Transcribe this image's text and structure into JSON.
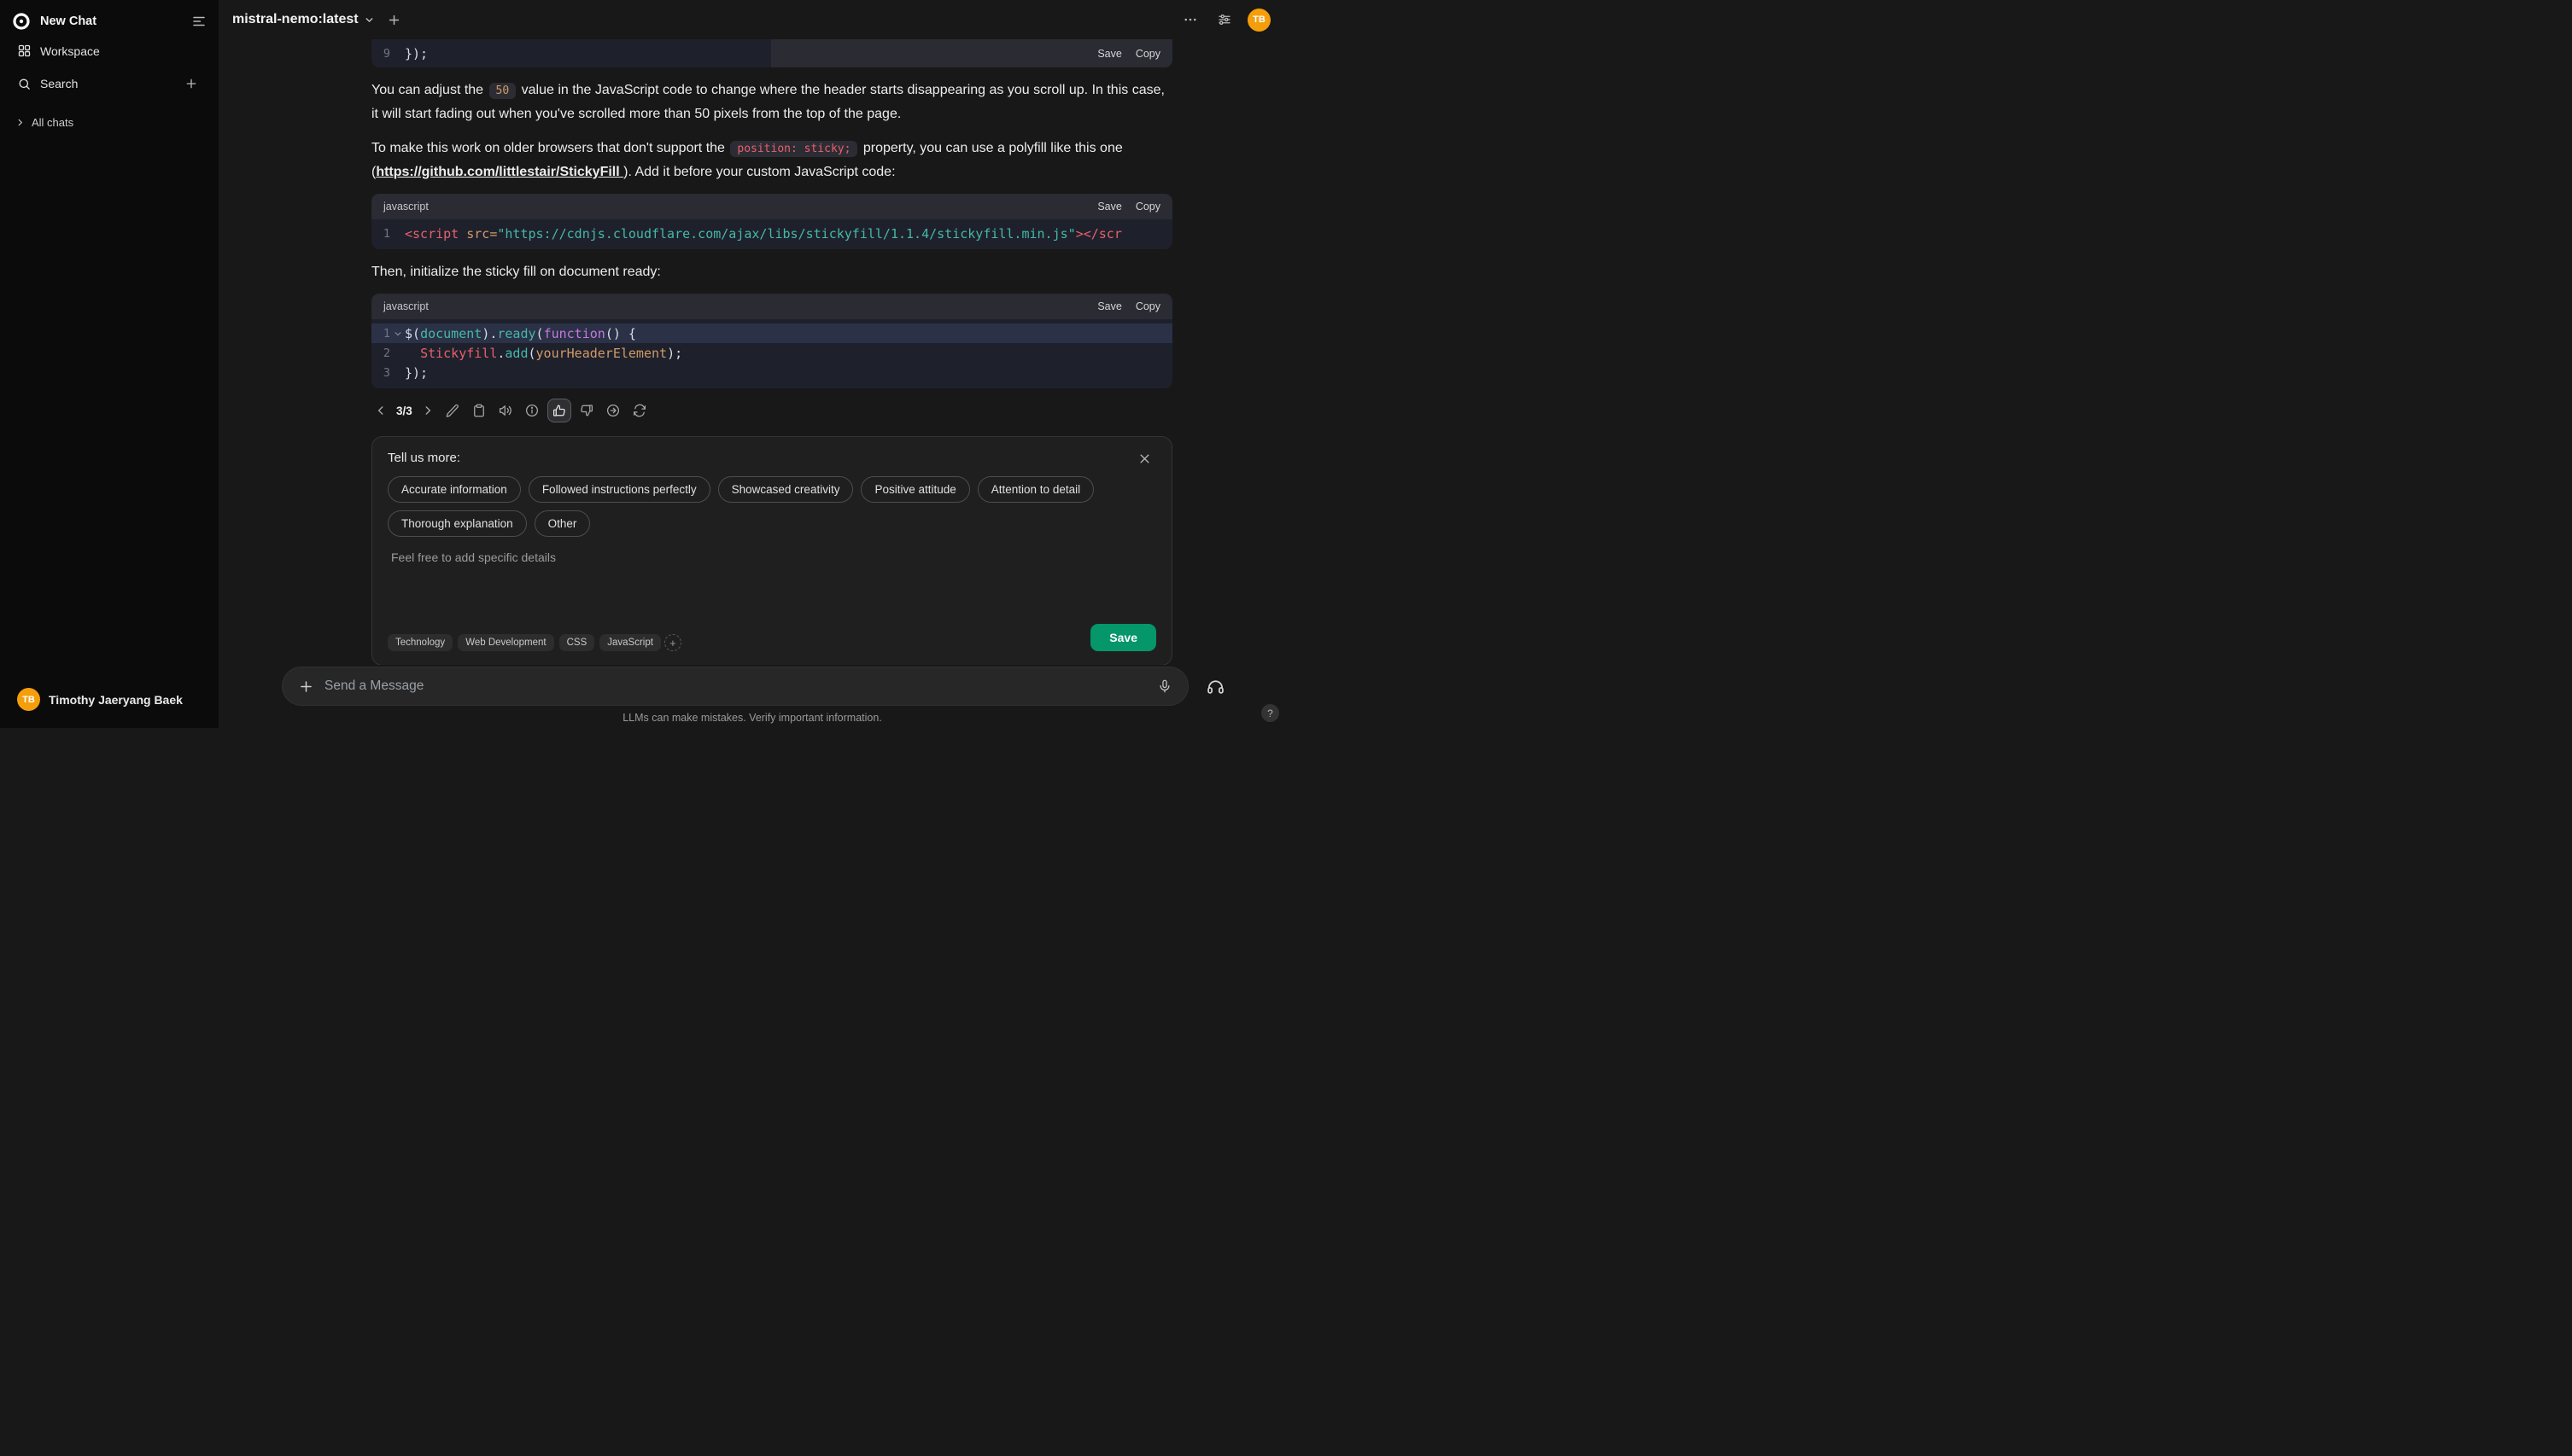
{
  "colors": {
    "accent_green": "#059669",
    "avatar_orange": "#f59e0b",
    "syntax": {
      "tag": "#e8606b",
      "attr": "#d19a66",
      "string": "#46b8a8",
      "keyword": "#c678dd",
      "ident": "#46b8a8",
      "plain": "#d8dee6",
      "number": "#d19a66"
    }
  },
  "icons": [
    "app-logo",
    "sidebar-toggle",
    "workspace-grid",
    "search",
    "plus",
    "chevron-right",
    "chevron-down",
    "chevron-left",
    "ellipsis",
    "controls-sliders",
    "edit-pencil",
    "copy-clipboard",
    "read-aloud-speaker",
    "info",
    "thumbs-up",
    "thumbs-down",
    "continue-arrow-circle",
    "regenerate-refresh",
    "close-x",
    "microphone",
    "headphones",
    "fold-chevron"
  ],
  "sidebar": {
    "new_chat": "New Chat",
    "workspace": "Workspace",
    "search": "Search",
    "all_chats": "All chats",
    "user": {
      "initials": "TB",
      "name": "Timothy Jaeryang Baek"
    }
  },
  "header": {
    "model": "mistral-nemo:latest",
    "avatar_initials": "TB"
  },
  "chat": {
    "partial_block": {
      "save": "Save",
      "copy": "Copy",
      "lines": [
        {
          "no": "9",
          "tokens": [
            {
              "t": "});",
              "c": "plain"
            }
          ]
        }
      ]
    },
    "para1": [
      {
        "type": "text",
        "t": "You can adjust the "
      },
      {
        "type": "code",
        "t": "50",
        "c": "number"
      },
      {
        "type": "text",
        "t": " value in the JavaScript code to change where the header starts disappearing as you scroll up. In this case, it will start fading out when you've scrolled more than 50 pixels from the top of the page."
      }
    ],
    "para2": [
      {
        "type": "text",
        "t": "To make this work on older browsers that don't support the "
      },
      {
        "type": "code",
        "t": "position: sticky;",
        "c": "tag"
      },
      {
        "type": "text",
        "t": " property, you can use a polyfill like this one ("
      },
      {
        "type": "link",
        "t": "https://github.com/littlestair/StickyFill "
      },
      {
        "type": "text",
        "t": "). Add it before your custom JavaScript code:"
      }
    ],
    "code1": {
      "lang": "javascript",
      "save": "Save",
      "copy": "Copy",
      "lines": [
        {
          "no": "1",
          "tokens": [
            {
              "t": "<script ",
              "c": "tag"
            },
            {
              "t": "src=",
              "c": "attr"
            },
            {
              "t": "\"https://cdnjs.cloudflare.com/ajax/libs/stickyfill/1.1.4/stickyfill.min.js\"",
              "c": "string"
            },
            {
              "t": "></scr",
              "c": "tag"
            }
          ]
        }
      ]
    },
    "para3": "Then, initialize the sticky fill on document ready:",
    "code2": {
      "lang": "javascript",
      "save": "Save",
      "copy": "Copy",
      "lines": [
        {
          "no": "1",
          "fold": true,
          "highlight": true,
          "tokens": [
            {
              "t": "$(",
              "c": "plain"
            },
            {
              "t": "document",
              "c": "ident"
            },
            {
              "t": ").",
              "c": "plain"
            },
            {
              "t": "ready",
              "c": "ident"
            },
            {
              "t": "(",
              "c": "plain"
            },
            {
              "t": "function",
              "c": "keyword"
            },
            {
              "t": "() {",
              "c": "plain"
            }
          ]
        },
        {
          "no": "2",
          "tokens": [
            {
              "t": "  ",
              "c": "plain"
            },
            {
              "t": "Stickyfill",
              "c": "tag"
            },
            {
              "t": ".",
              "c": "plain"
            },
            {
              "t": "add",
              "c": "ident"
            },
            {
              "t": "(",
              "c": "plain"
            },
            {
              "t": "yourHeaderElement",
              "c": "attr"
            },
            {
              "t": ");",
              "c": "plain"
            }
          ]
        },
        {
          "no": "3",
          "tokens": [
            {
              "t": "});",
              "c": "plain"
            }
          ]
        }
      ]
    },
    "pager": {
      "current": "3/3"
    },
    "feedback": {
      "title": "Tell us more:",
      "reasons": [
        "Accurate information",
        "Followed instructions perfectly",
        "Showcased creativity",
        "Positive attitude",
        "Attention to detail",
        "Thorough explanation",
        "Other"
      ],
      "comment_placeholder": "Feel free to add specific details",
      "tags": [
        "Technology",
        "Web Development",
        "CSS",
        "JavaScript"
      ],
      "add_tag": "+",
      "save": "Save"
    }
  },
  "composer": {
    "placeholder": "Send a Message",
    "footer_note": "LLMs can make mistakes. Verify important information.",
    "help": "?"
  }
}
